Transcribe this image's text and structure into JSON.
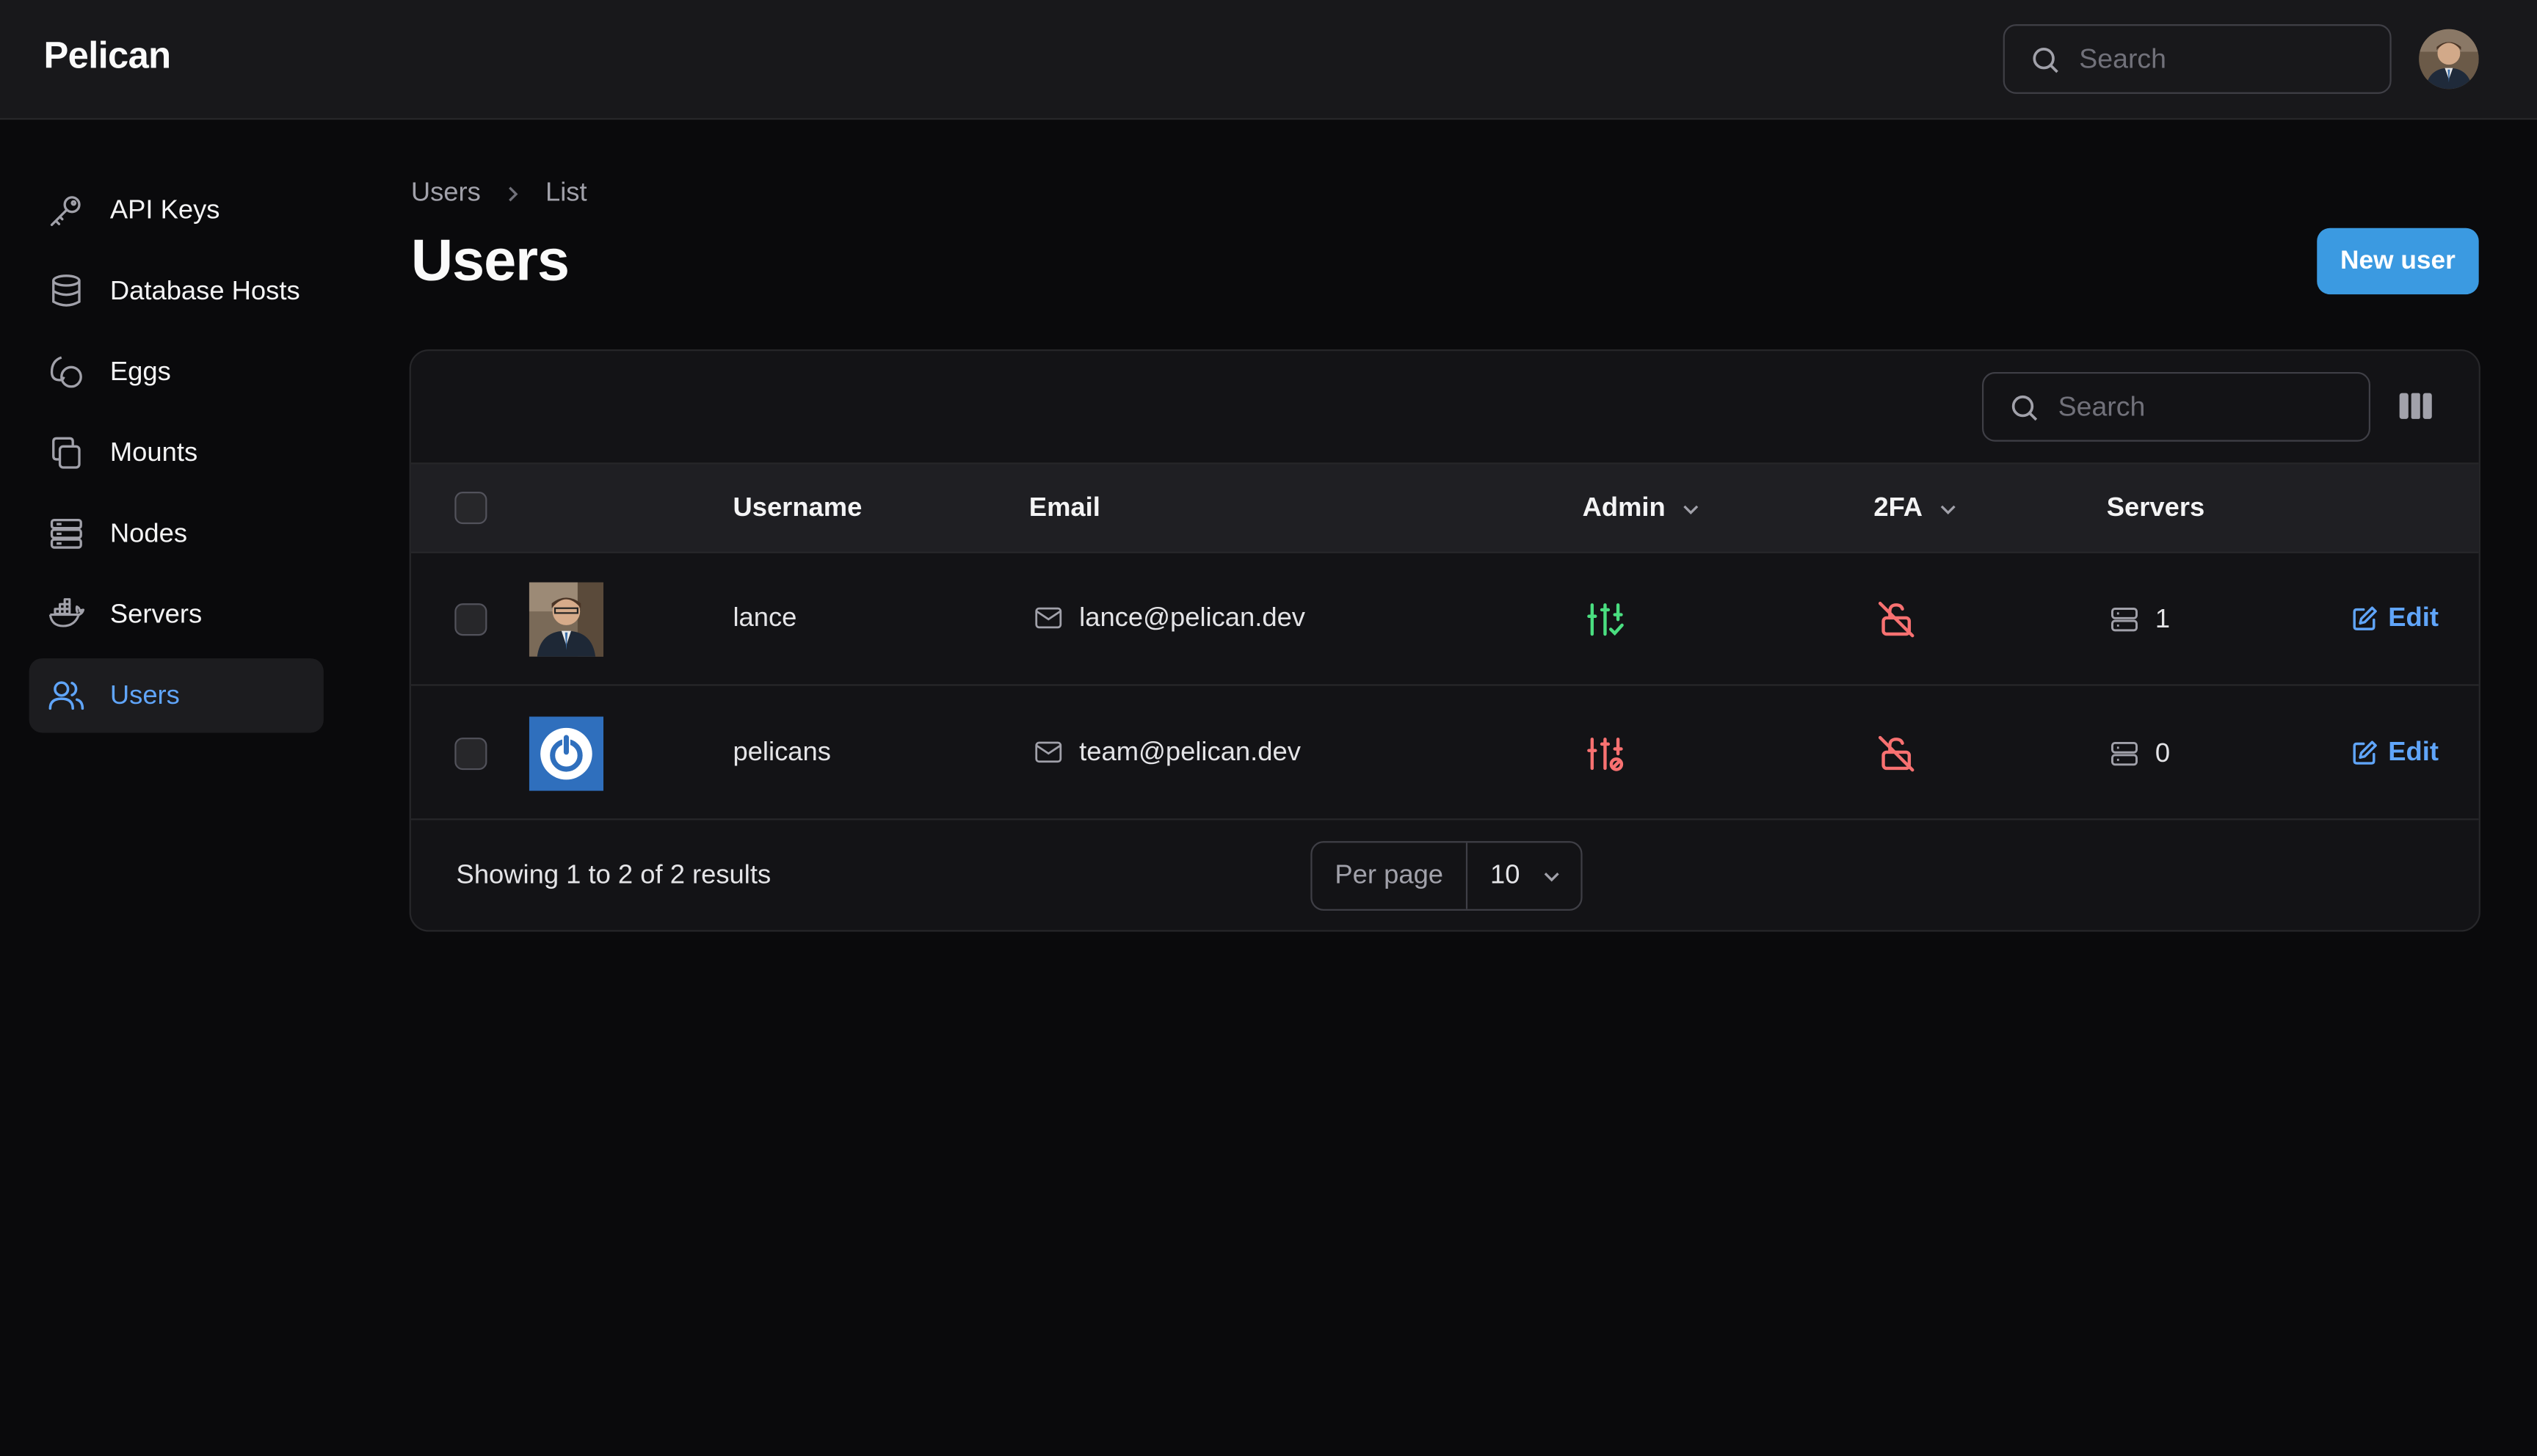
{
  "app": {
    "brand": "Pelican"
  },
  "topbar": {
    "search_placeholder": "Search"
  },
  "sidebar": {
    "items": [
      {
        "label": "API Keys",
        "icon": "key-icon"
      },
      {
        "label": "Database Hosts",
        "icon": "database-icon"
      },
      {
        "label": "Eggs",
        "icon": "egg-icon"
      },
      {
        "label": "Mounts",
        "icon": "copy-icon"
      },
      {
        "label": "Nodes",
        "icon": "server-stack-icon"
      },
      {
        "label": "Servers",
        "icon": "docker-icon"
      },
      {
        "label": "Users",
        "icon": "users-icon",
        "active": true
      }
    ]
  },
  "breadcrumb": {
    "root": "Users",
    "current": "List"
  },
  "page": {
    "title": "Users",
    "new_button": "New user"
  },
  "table": {
    "search_placeholder": "Search",
    "columns": {
      "username": "Username",
      "email": "Email",
      "admin": "Admin",
      "twofa": "2FA",
      "servers": "Servers"
    },
    "rows": [
      {
        "username": "lance",
        "email": "lance@pelican.dev",
        "admin": true,
        "twofa": false,
        "servers": "1",
        "edit": "Edit",
        "avatar": "photo"
      },
      {
        "username": "pelicans",
        "email": "team@pelican.dev",
        "admin": false,
        "twofa": false,
        "servers": "0",
        "edit": "Edit",
        "avatar": "power-logo"
      }
    ],
    "summary": "Showing 1 to 2 of 2 results",
    "per_page_label": "Per page",
    "per_page_value": "10"
  },
  "colors": {
    "accent": "#3b9ae1",
    "link": "#60a5fa",
    "success": "#4ade80",
    "danger": "#f87171"
  }
}
